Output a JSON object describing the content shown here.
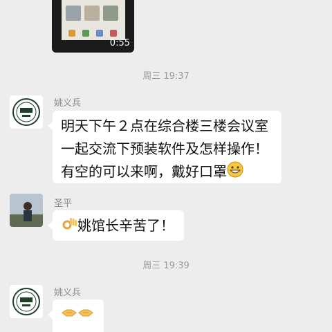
{
  "video_message": {
    "duration": "0:55"
  },
  "timestamps": [
    "周三 19:37",
    "周三 19:39"
  ],
  "messages": [
    {
      "sender": "姚义兵",
      "lines": [
        "明天下午２点在综合楼三楼会议室",
        "一起交流下预装软件及怎样操作！",
        "有空的可以来啊，戴好口罩"
      ],
      "emoji": "grinning-face"
    },
    {
      "sender": "圣平",
      "lead_emoji": "ok-hand",
      "text": "姚馆长辛苦了！"
    },
    {
      "sender": "姚义兵",
      "emoji": [
        "handshake",
        "handshake"
      ]
    }
  ],
  "colors": {
    "background": "#ededed",
    "bubble": "#ffffff",
    "meta_text": "#9b9b9b"
  }
}
